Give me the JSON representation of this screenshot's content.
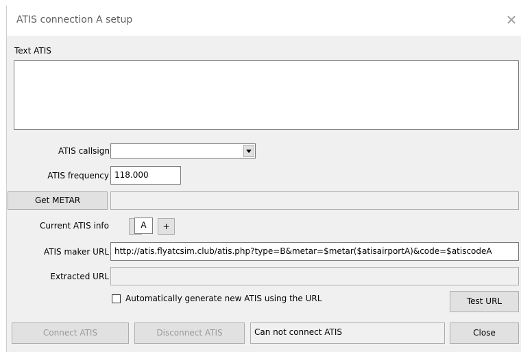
{
  "window": {
    "title": "ATIS connection A setup",
    "close_icon": "close-icon"
  },
  "text_atis": {
    "label": "Text ATIS",
    "value": ""
  },
  "callsign": {
    "label": "ATIS callsign",
    "value": ""
  },
  "frequency": {
    "label": "ATIS frequency",
    "value": "118.000"
  },
  "metar": {
    "button": "Get METAR",
    "value": ""
  },
  "current_info": {
    "label": "Current ATIS info",
    "minus": "-",
    "value": "A",
    "plus": "+"
  },
  "maker_url": {
    "label": "ATIS maker URL",
    "value": "http://atis.flyatcsim.club/atis.php?type=B&metar=$metar($atisairportA)&code=$atiscodeA"
  },
  "extracted_url": {
    "label": "Extracted URL",
    "value": ""
  },
  "auto_generate": {
    "label": "Automatically generate new ATIS using the URL",
    "checked": false
  },
  "buttons": {
    "test_url": "Test URL",
    "connect": "Connect ATIS",
    "disconnect": "Disconnect ATIS",
    "close": "Close"
  },
  "status": "Can not connect ATIS"
}
